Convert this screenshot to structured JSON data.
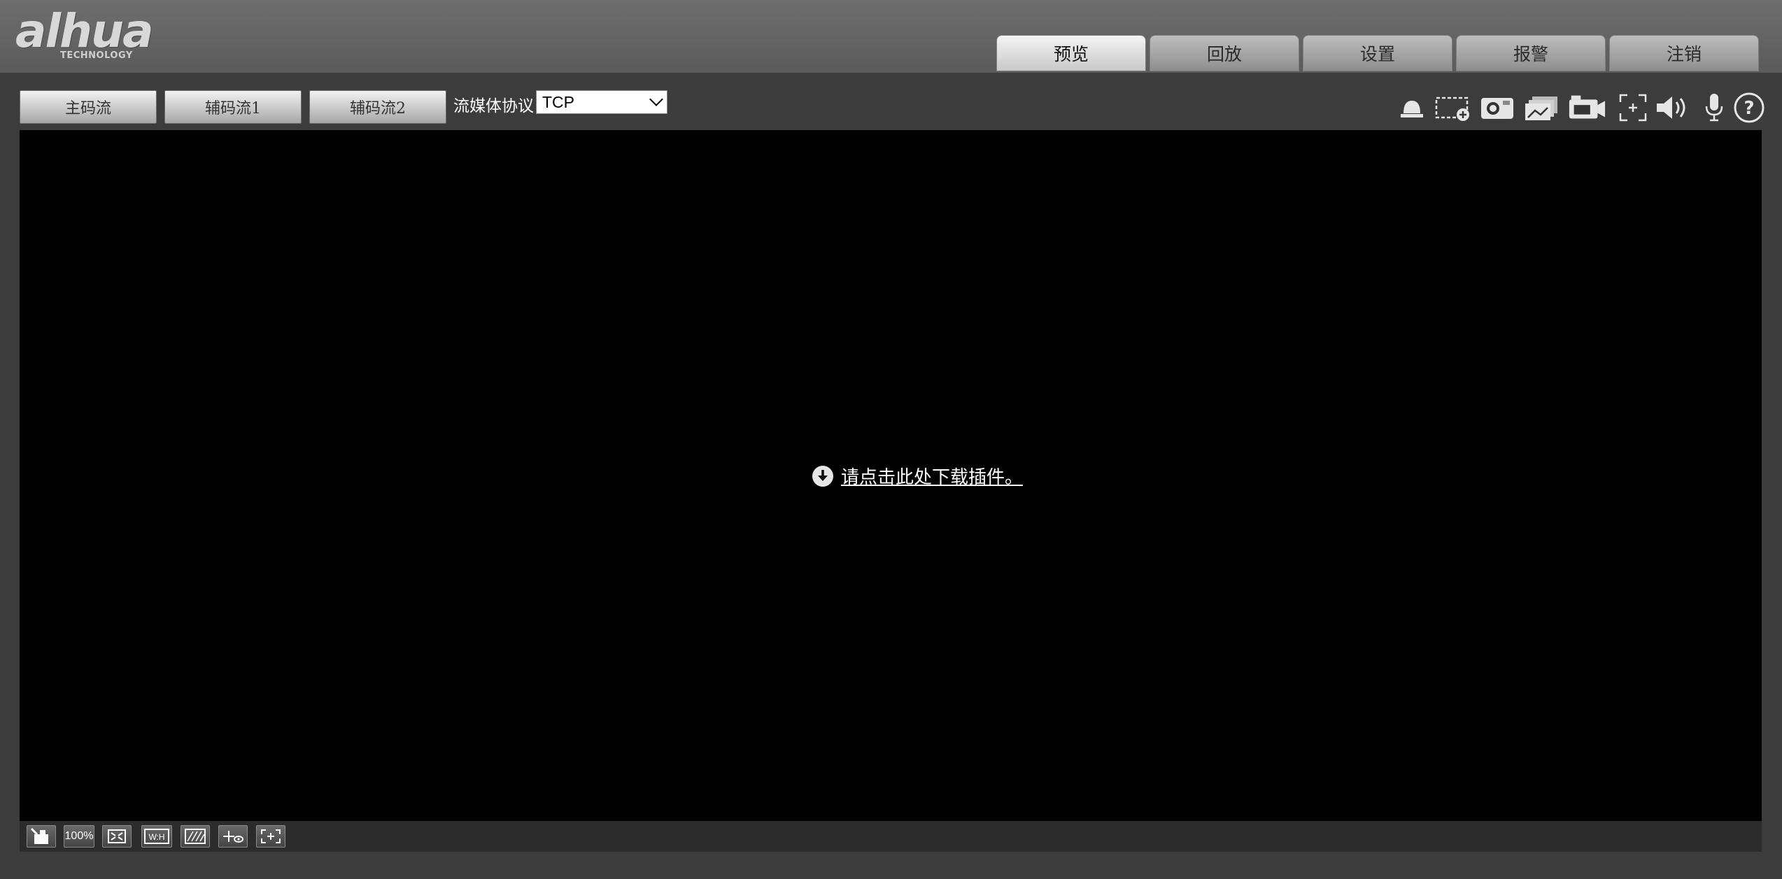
{
  "header": {
    "logo_text": "alhua",
    "logo_sub": "TECHNOLOGY",
    "tabs": [
      {
        "label": "预览",
        "active": true
      },
      {
        "label": "回放",
        "active": false
      },
      {
        "label": "设置",
        "active": false
      },
      {
        "label": "报警",
        "active": false
      },
      {
        "label": "注销",
        "active": false
      }
    ]
  },
  "toolbar": {
    "streams": [
      "主码流",
      "辅码流1",
      "辅码流2"
    ],
    "protocol_label": "流媒体协议",
    "protocol_value": "TCP",
    "icons": [
      "alarm-light-icon",
      "region-zoom-icon",
      "snapshot-icon",
      "triple-snapshot-icon",
      "record-icon",
      "easy-focus-icon",
      "audio-icon",
      "microphone-icon",
      "help-icon"
    ]
  },
  "video": {
    "plugin_text": "请点击此处下载插件。"
  },
  "bottom_bar": {
    "icons": [
      "image-adjust-icon",
      "original-size-icon",
      "fit-window-icon",
      "aspect-ratio-icon",
      "smooth-icon",
      "rule-icon",
      "fullscreen-icon"
    ],
    "zoom_label": "100%"
  },
  "colors": {
    "header_bg": "#666666",
    "body_bg": "#3c3c3c",
    "video_bg": "#000000"
  }
}
